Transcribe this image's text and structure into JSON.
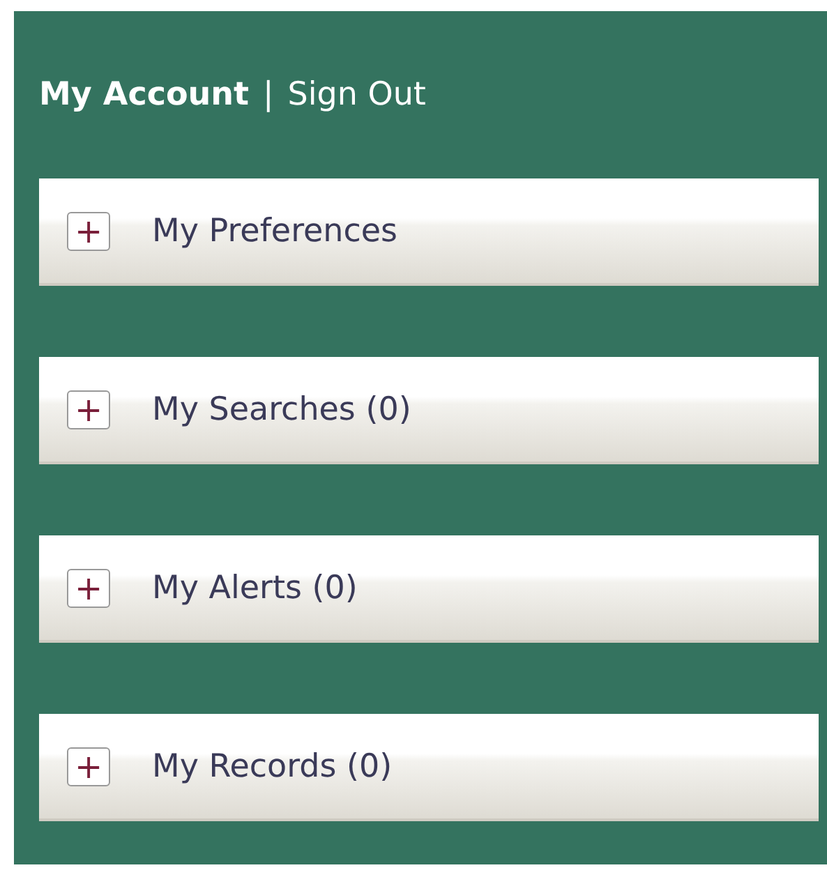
{
  "header": {
    "account": "My Account",
    "separator": "|",
    "sign_out": "Sign Out"
  },
  "sections": [
    {
      "label": "My Preferences",
      "expanded": false,
      "toggle": "+"
    },
    {
      "label": "My Searches (0)",
      "expanded": false,
      "toggle": "+"
    },
    {
      "label": "My Alerts (0)",
      "expanded": false,
      "toggle": "+"
    },
    {
      "label": "My Records (0)",
      "expanded": false,
      "toggle": "+"
    }
  ]
}
